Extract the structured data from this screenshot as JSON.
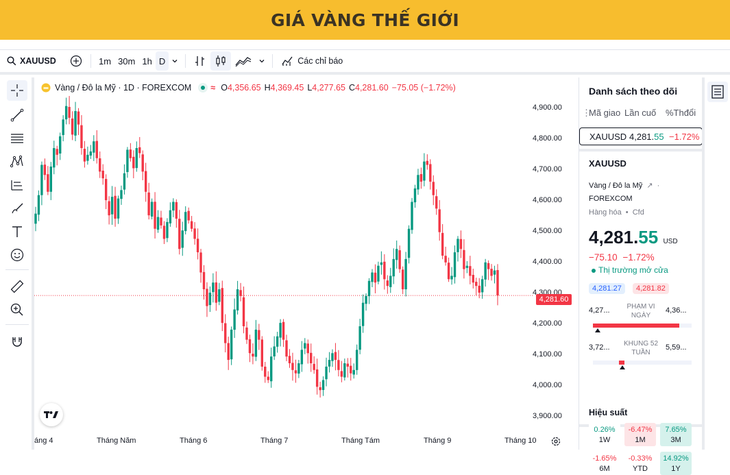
{
  "banner": {
    "title": "GIÁ VÀNG THẾ GIỚI"
  },
  "toolbar": {
    "symbol": "XAUUSD",
    "intervals": [
      "1m",
      "30m",
      "1h",
      "D"
    ],
    "indicators_label": "Các chỉ báo"
  },
  "legend": {
    "title": "Vàng / Đô la Mỹ · 1D · FOREXCOM",
    "o_label": "O",
    "o": "4,356.65",
    "h_label": "H",
    "h": "4,369.45",
    "l_label": "L",
    "l": "4,277.65",
    "c_label": "C",
    "c": "4,281.60",
    "change": "−75.05 (−1.72%)"
  },
  "y_axis": [
    "4,900.00",
    "4,800.00",
    "4,700.00",
    "4,600.00",
    "4,500.00",
    "4,400.00",
    "4,300.00",
    "4,200.00",
    "4,100.00",
    "4,000.00",
    "3,900.00"
  ],
  "x_axis": [
    "áng 4",
    "Tháng Năm",
    "Tháng 6",
    "Tháng 7",
    "Tháng Tám",
    "Tháng 9",
    "Tháng 10"
  ],
  "last_price_tag": "4,281.60",
  "watchlist": {
    "title": "Danh sách theo dõi",
    "col_symbol": "Mã giao",
    "col_last": "Lần cuố",
    "col_change": "%Thđổi",
    "row": {
      "symbol": "XAUUSD",
      "last_main": "4,281.",
      "last_frac": "55",
      "change": "−1.72%"
    }
  },
  "details": {
    "symbol": "XAUUSD",
    "name": "Vàng / Đô la Mỹ",
    "exchange": "FOREXCOM",
    "category": "Hàng hóa",
    "type": "Cfd",
    "price_main": "4,281.",
    "price_frac": "55",
    "currency": "USD",
    "change": "−75.10",
    "change_pct": "−1.72%",
    "market_status": "Thị trường mở cửa",
    "bid": "4,281.27",
    "ask": "4,281.82",
    "day_low": "4,27...",
    "day_label_1": "PHẠM VI",
    "day_label_2": "NGÀY",
    "day_high": "4,36...",
    "day_position": 0.05,
    "week_low": "3,72...",
    "week_label_1": "KHUNG 52",
    "week_label_2": "TUẦN",
    "week_high": "5,59...",
    "week_position": 0.3
  },
  "performance": {
    "title": "Hiệu suất",
    "items": [
      {
        "value": "0.26%",
        "period": "1W",
        "positive": true
      },
      {
        "value": "-6.47%",
        "period": "1M",
        "positive": false
      },
      {
        "value": "7.65%",
        "period": "3M",
        "positive": true
      },
      {
        "value": "-1.65%",
        "period": "6M",
        "positive": false
      },
      {
        "value": "-0.33%",
        "period": "YTD",
        "positive": false
      },
      {
        "value": "14.92%",
        "period": "1Y",
        "positive": true
      }
    ]
  },
  "colors": {
    "up": "#089981",
    "down": "#f23645",
    "banner": "#f7bd2e"
  },
  "chart_data": {
    "type": "candlestick",
    "ylim": [
      3870,
      4930
    ],
    "close_last": 4281.6,
    "closes": [
      4525,
      4580,
      4670,
      4640,
      4590,
      4665,
      4720,
      4700,
      4755,
      4805,
      4845,
      4810,
      4760,
      4830,
      4790,
      4720,
      4680,
      4700,
      4710,
      4740,
      4690,
      4650,
      4630,
      4565,
      4520,
      4575,
      4510,
      4570,
      4595,
      4645,
      4715,
      4690,
      4660,
      4720,
      4705,
      4650,
      4590,
      4520,
      4560,
      4480,
      4515,
      4490,
      4450,
      4500,
      4535,
      4560,
      4510,
      4420,
      4475,
      4530,
      4505,
      4480,
      4450,
      4410,
      4350,
      4300,
      4250,
      4290,
      4320,
      4260,
      4300,
      4200,
      4140,
      4090,
      4180,
      4240,
      4300,
      4280,
      4190,
      4150,
      4110,
      4100,
      4180,
      4150,
      4070,
      4040,
      4030,
      4100,
      4130,
      4160,
      4200,
      4150,
      4100,
      4080,
      4060,
      4050,
      4080,
      4120,
      4140,
      4110,
      4080,
      4060,
      4010,
      4000,
      4030,
      4070,
      4090,
      4110,
      4090,
      4060,
      4040,
      4080,
      4070,
      4050,
      4060,
      4120,
      4190,
      4260,
      4280,
      4325,
      4350,
      4320,
      4370,
      4380,
      4330,
      4310,
      4340,
      4390,
      4420,
      4360,
      4300,
      4390,
      4480,
      4560,
      4600,
      4640,
      4620,
      4680,
      4670,
      4620,
      4580,
      4540,
      4470,
      4400,
      4380,
      4330,
      4340,
      4410,
      4450,
      4420,
      4360,
      4370,
      4340,
      4320,
      4310,
      4290,
      4330,
      4380,
      4360,
      4340,
      4356,
      4281.6
    ]
  }
}
